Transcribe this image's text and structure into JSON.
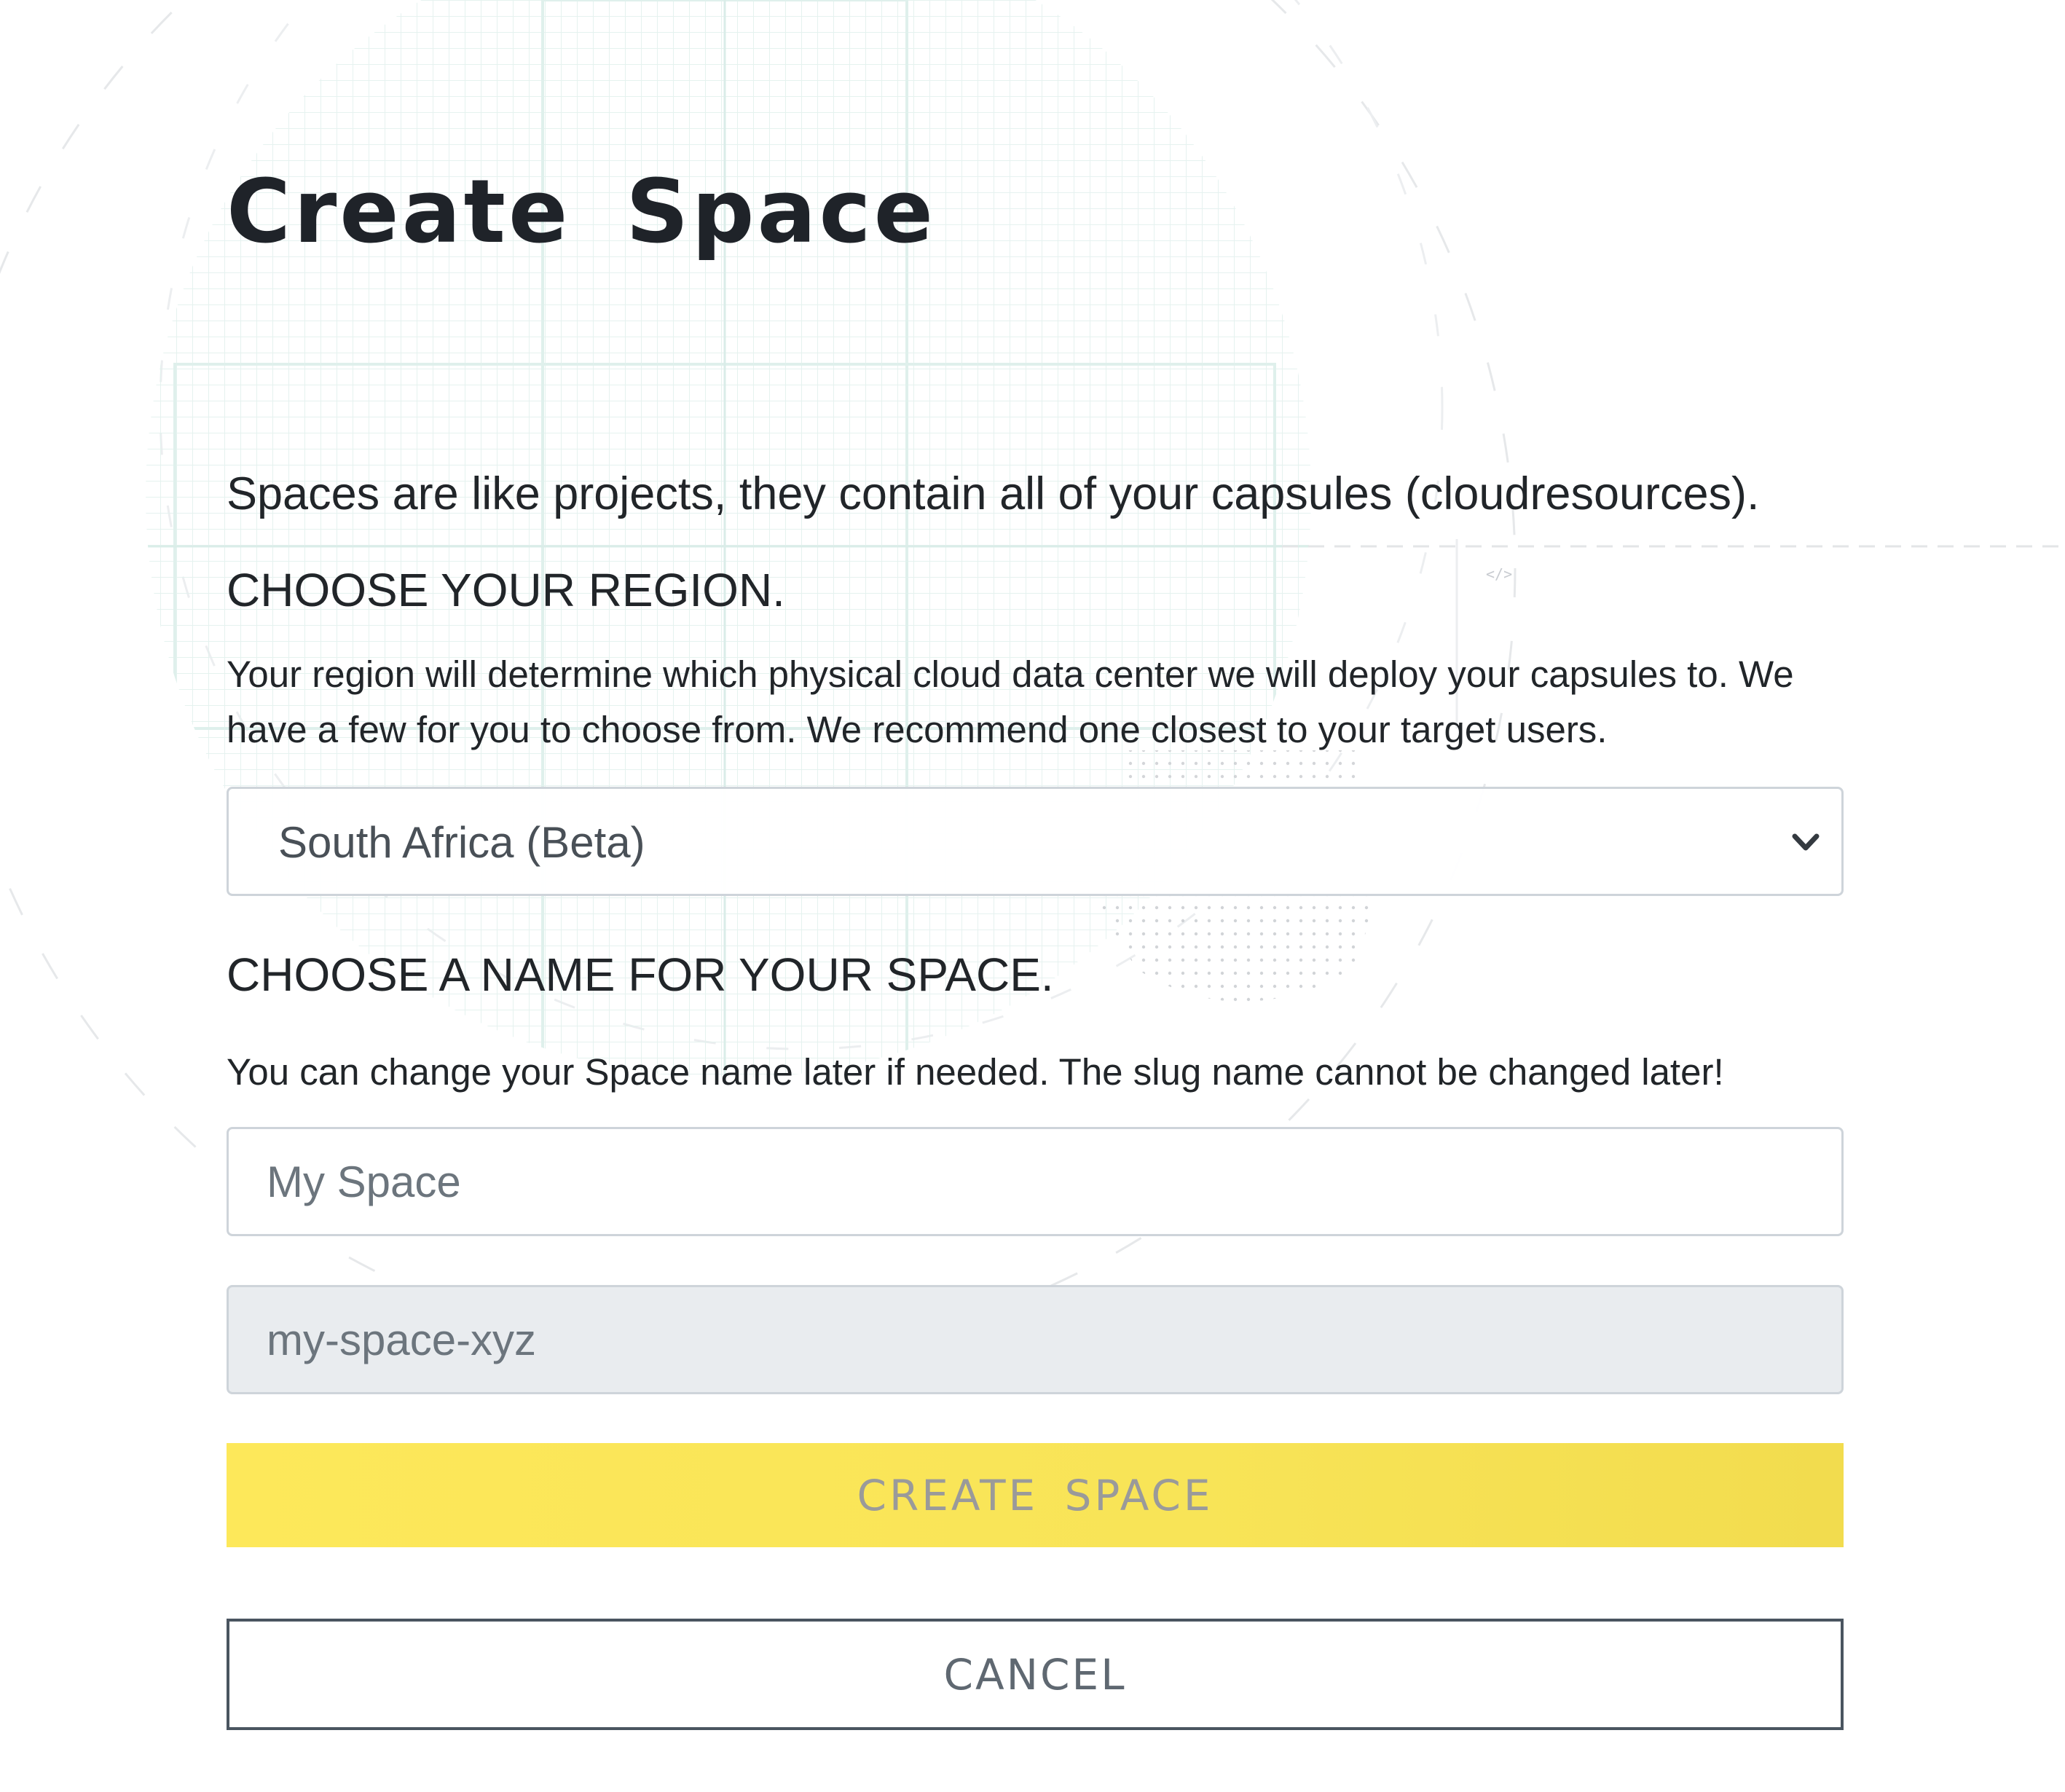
{
  "page": {
    "title": "Create Space",
    "intro": "Spaces are like projects, they contain all of your capsules (cloudresources).",
    "code_glyph": "</>"
  },
  "region": {
    "heading": "CHOOSE YOUR REGION.",
    "help": "Your region will determine which physical cloud data center we will deploy your capsules to. We have a few for you to choose from. We recommend one closest to your target users.",
    "selected": "South Africa (Beta)"
  },
  "name_section": {
    "heading": "CHOOSE A NAME FOR YOUR SPACE.",
    "help": "You can change your Space name later if needed. The slug name cannot be changed later!",
    "name_placeholder": "My Space",
    "slug_placeholder": "my-space-xyz"
  },
  "actions": {
    "create_label": "CREATE SPACE",
    "cancel_label": "CANCEL"
  },
  "colors": {
    "create_button": "#fbe65a",
    "cancel_border": "#4a5560",
    "text": "#212529",
    "slug_background": "#e9ecef"
  }
}
